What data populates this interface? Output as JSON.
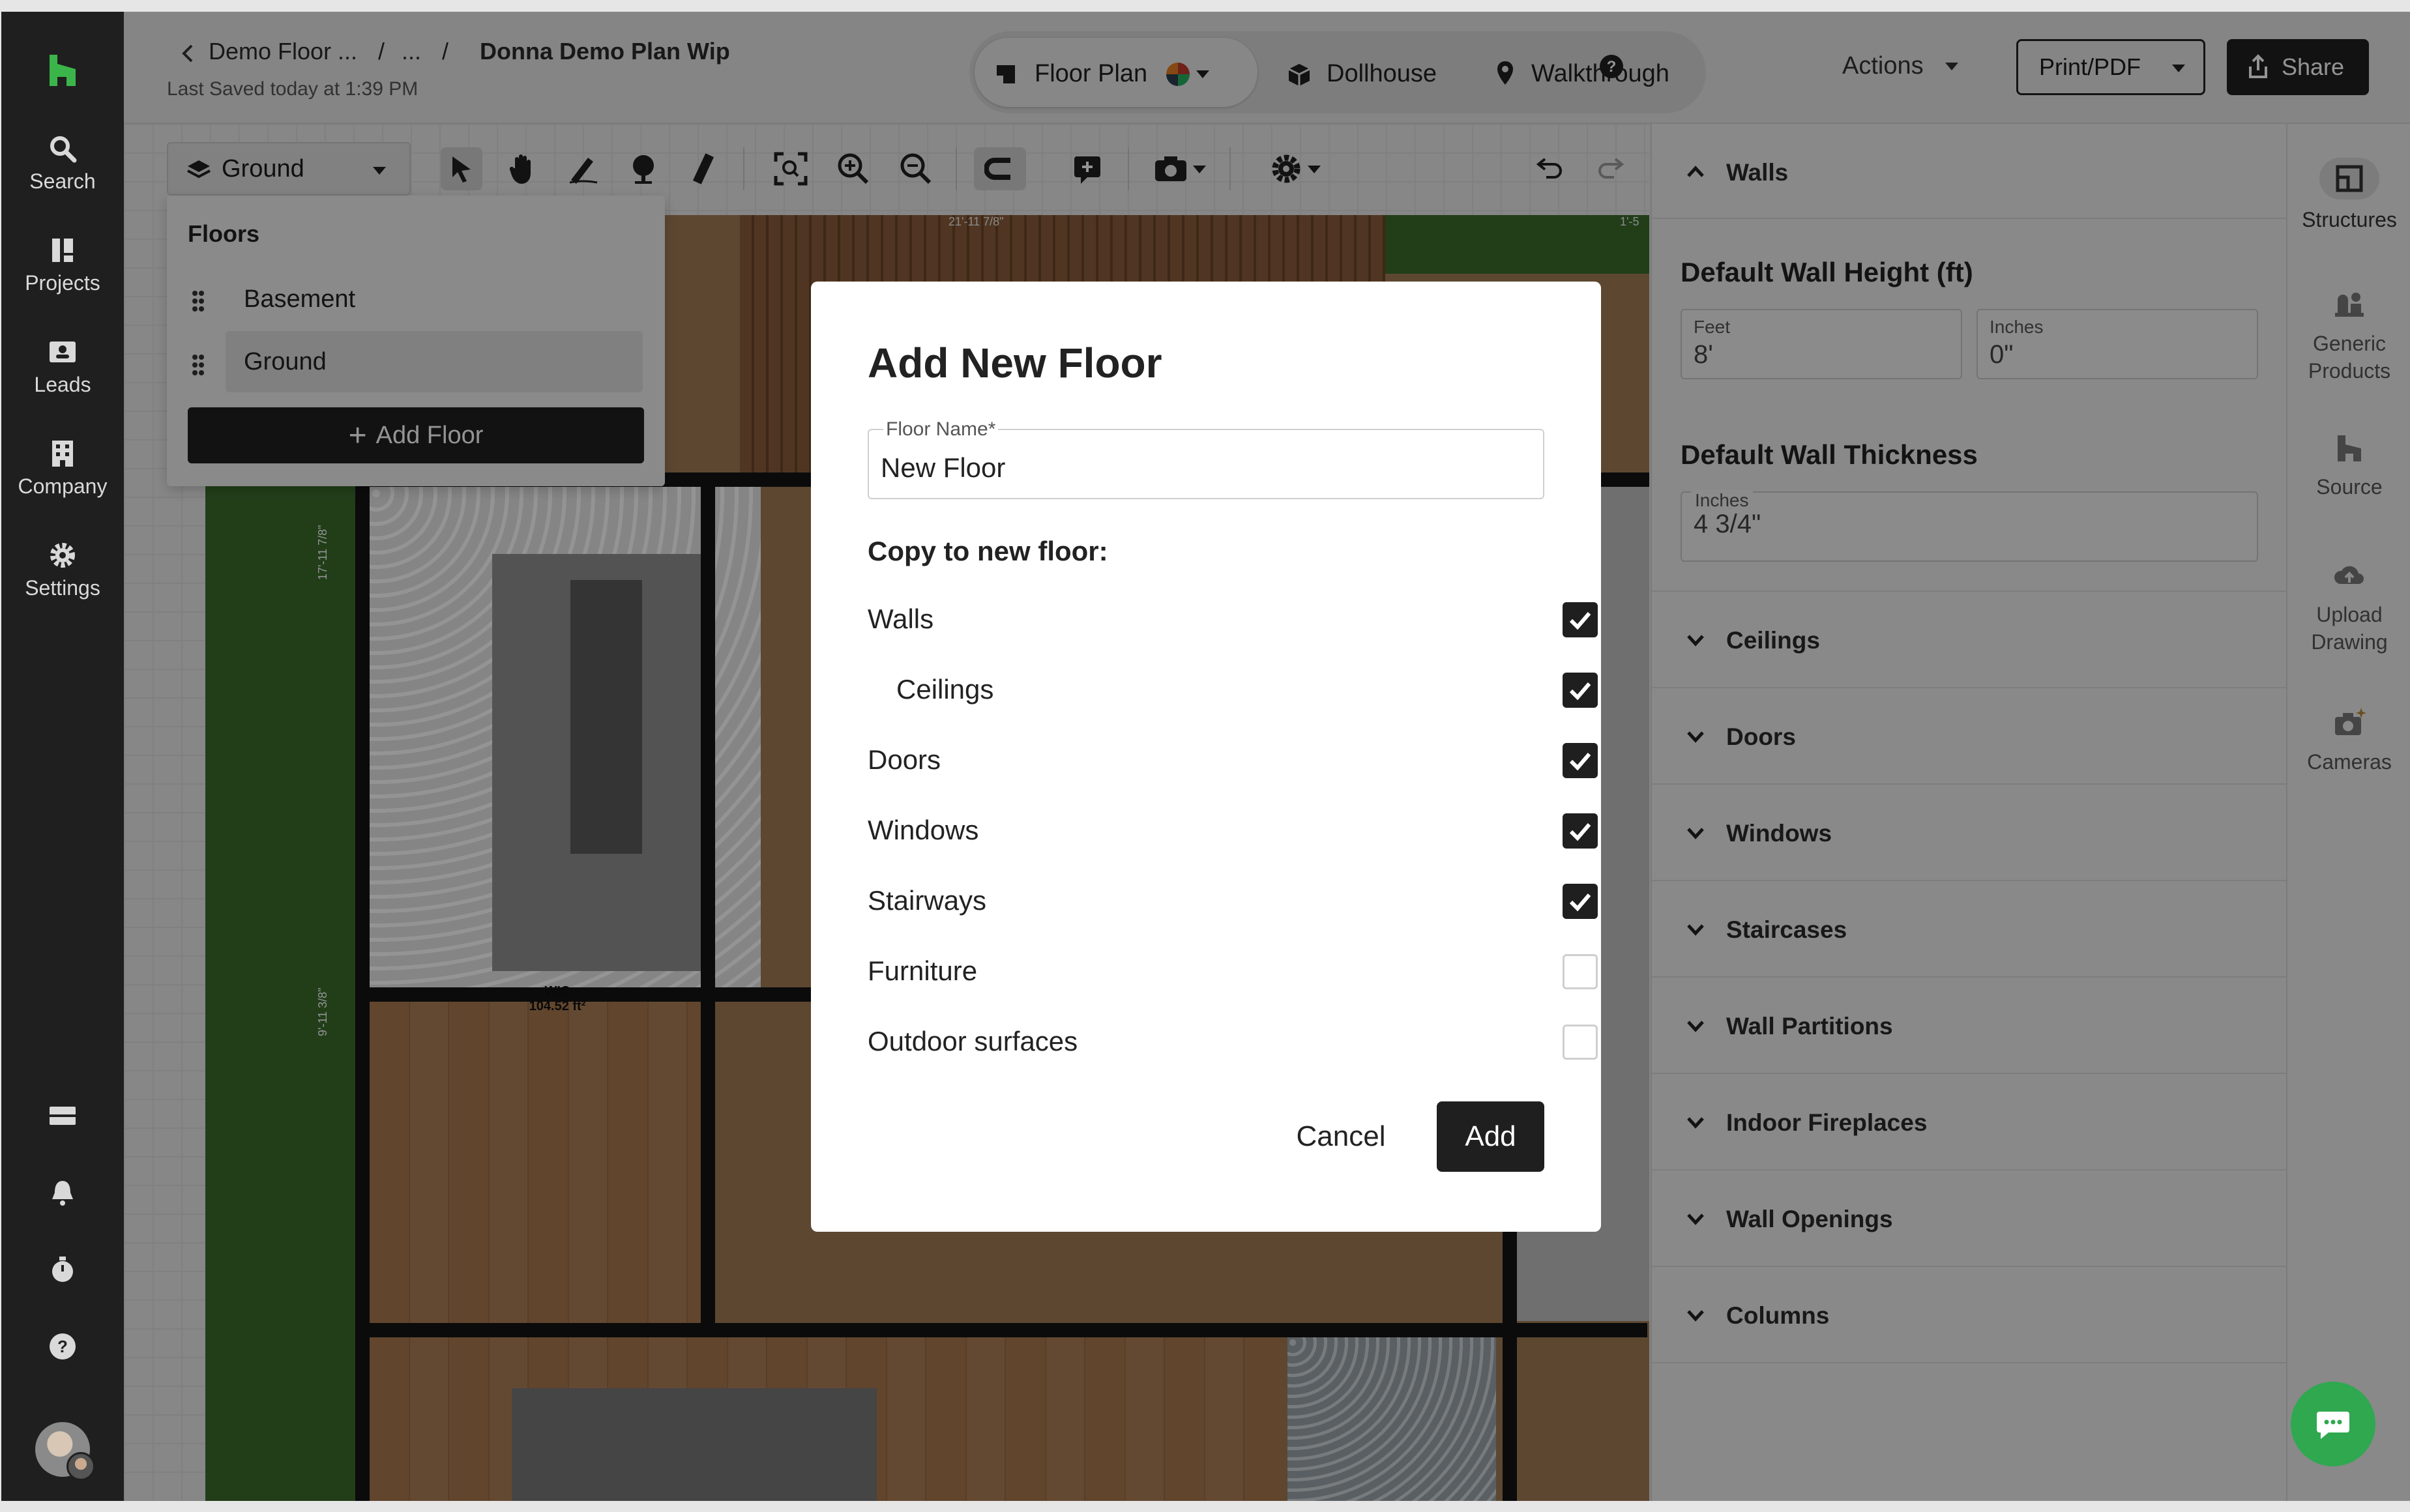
{
  "sidebar": {
    "items": [
      {
        "label": "Search",
        "icon": "search-icon"
      },
      {
        "label": "Projects",
        "icon": "projects-icon"
      },
      {
        "label": "Leads",
        "icon": "leads-icon"
      },
      {
        "label": "Company",
        "icon": "company-icon"
      },
      {
        "label": "Settings",
        "icon": "gear-icon"
      }
    ],
    "bottom_icons": [
      "inbox-icon",
      "bell-icon",
      "timer-icon",
      "help-icon"
    ]
  },
  "header": {
    "back_crumb": "Demo Floor ...",
    "mid_crumb": "...",
    "sep": "/",
    "title": "Donna Demo Plan Wip",
    "last_saved": "Last Saved today at 1:39 PM",
    "modes": [
      "Floor Plan",
      "Dollhouse",
      "Walkthrough"
    ],
    "actions_label": "Actions",
    "print_label": "Print/PDF",
    "share_label": "Share"
  },
  "toolbar": {
    "floor_selected": "Ground"
  },
  "floors_dropdown": {
    "title": "Floors",
    "items": [
      "Basement",
      "Ground"
    ],
    "add_label": "Add Floor"
  },
  "plan_labels": {
    "room_name": "WIC",
    "room_area": "104.52 ft²",
    "dim_a": "17'-11 7/8\"",
    "dim_b": "9'-11 3/8\"",
    "dim_top": "21'-11 7/8\"",
    "dim_top_right": "1'-5"
  },
  "right_panel": {
    "walls_header": "Walls",
    "wall_height_title": "Default Wall Height (ft)",
    "feet_label": "Feet",
    "feet_value": "8'",
    "inches_label": "Inches",
    "inches_value": "0\"",
    "wall_thickness_title": "Default Wall Thickness",
    "thickness_label": "Inches",
    "thickness_value": "4 3/4\"",
    "sections": [
      "Ceilings",
      "Doors",
      "Windows",
      "Staircases",
      "Wall Partitions",
      "Indoor Fireplaces",
      "Wall Openings",
      "Columns"
    ]
  },
  "right_rail": {
    "items": [
      {
        "label": "Structures",
        "icon": "structures-icon"
      },
      {
        "label": "Generic Products",
        "icon": "generic-products-icon"
      },
      {
        "label": "Source",
        "icon": "source-icon"
      },
      {
        "label": "Upload Drawing",
        "icon": "upload-icon"
      },
      {
        "label": "Cameras",
        "icon": "camera-icon"
      }
    ]
  },
  "modal": {
    "title": "Add New Floor",
    "floor_name_label": "Floor Name*",
    "floor_name_value": "New Floor",
    "copy_label": "Copy to new floor:",
    "options": [
      {
        "label": "Walls",
        "checked": true
      },
      {
        "label": "Ceilings",
        "checked": true
      },
      {
        "label": "Doors",
        "checked": true
      },
      {
        "label": "Windows",
        "checked": true
      },
      {
        "label": "Stairways",
        "checked": true
      },
      {
        "label": "Furniture",
        "checked": false
      },
      {
        "label": "Outdoor surfaces",
        "checked": false
      }
    ],
    "cancel_label": "Cancel",
    "add_label": "Add"
  },
  "colors": {
    "brand_green": "#2fa84f",
    "dark": "#1f1f1f",
    "sidebar_bg": "#1f1f1f"
  }
}
